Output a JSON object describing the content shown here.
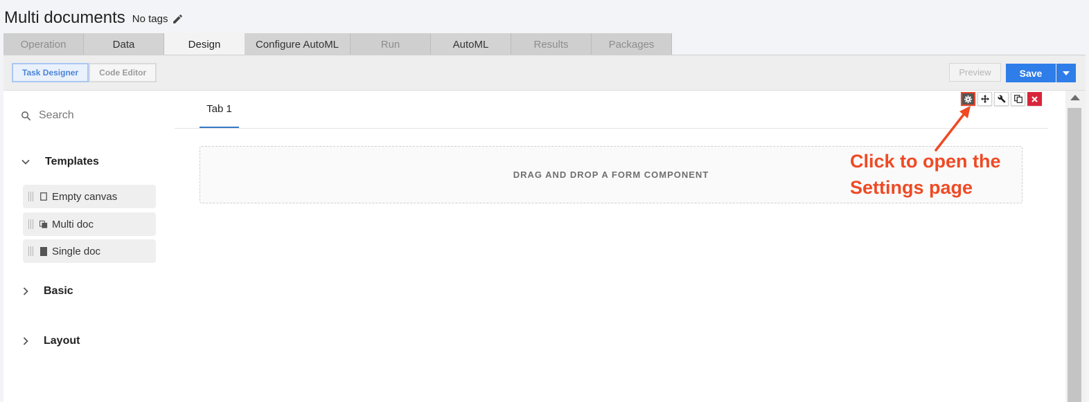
{
  "header": {
    "title": "Multi documents",
    "tags": "No tags"
  },
  "tabs": [
    {
      "label": "Operation",
      "state": "disabled"
    },
    {
      "label": "Data",
      "state": "enabled"
    },
    {
      "label": "Design",
      "state": "active"
    },
    {
      "label": "Configure AutoML",
      "state": "enabled"
    },
    {
      "label": "Run",
      "state": "disabled"
    },
    {
      "label": "AutoML",
      "state": "enabled"
    },
    {
      "label": "Results",
      "state": "disabled"
    },
    {
      "label": "Packages",
      "state": "disabled"
    }
  ],
  "toolbar": {
    "task_designer_label": "Task Designer",
    "code_editor_label": "Code Editor",
    "preview_label": "Preview",
    "save_label": "Save"
  },
  "sidebar": {
    "search_placeholder": "Search",
    "sections": {
      "templates": "Templates",
      "basic": "Basic",
      "layout": "Layout"
    },
    "templates": [
      {
        "label": "Empty canvas",
        "icon": "empty-canvas-icon"
      },
      {
        "label": "Multi doc",
        "icon": "multi-doc-icon"
      },
      {
        "label": "Single doc",
        "icon": "single-doc-icon"
      }
    ]
  },
  "canvas": {
    "tab_label": "Tab 1",
    "dropzone_text": "DRAG AND DROP A FORM COMPONENT",
    "controls": [
      "gear-icon",
      "move-icon",
      "wrench-icon",
      "copy-icon",
      "close-icon"
    ]
  },
  "annotation": {
    "line1": "Click to open the",
    "line2": "Settings page"
  },
  "colors": {
    "accent": "#2e7de9",
    "tab_underline": "#3578c6",
    "annotation": "#ef4a25",
    "delete": "#d9253b"
  }
}
